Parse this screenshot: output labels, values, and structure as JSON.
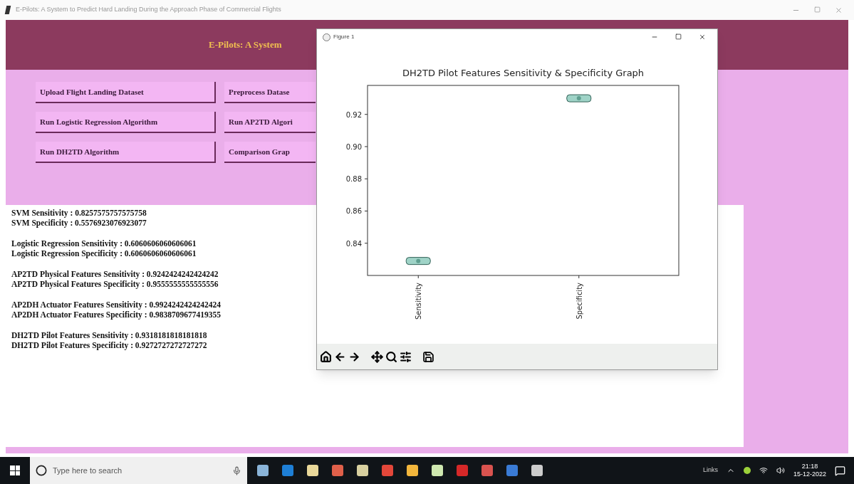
{
  "window": {
    "title": "E-Pilots: A System to Predict Hard Landing During the Approach Phase of Commercial Flights"
  },
  "header": {
    "title": "E-Pilots: A System"
  },
  "buttons": [
    [
      "Upload Flight Landing Dataset",
      "Preprocess Datase"
    ],
    [
      "Run Logistic Regression Algorithm",
      "Run AP2TD Algori"
    ],
    [
      "Run DH2TD Algorithm",
      "Comparison Grap"
    ]
  ],
  "results": [
    [
      "SVM Sensitivity : 0.8257575757575758",
      "SVM Specificity : 0.5576923076923077"
    ],
    [
      "Logistic Regression Sensitivity : 0.6060606060606061",
      "Logistic Regression Specificity : 0.6060606060606061"
    ],
    [
      "AP2TD Physical Features Sensitivity : 0.9242424242424242",
      "AP2TD Physical Features Specificity : 0.9555555555555556"
    ],
    [
      "AP2DH Actuator Features Sensitivity : 0.9924242424242424",
      "AP2DH Actuator Features Specificity : 0.9838709677419355"
    ],
    [
      "DH2TD Pilot Features Sensitivity : 0.9318181818181818",
      "DH2TD Pilot Features Specificity : 0.9272727272727272"
    ]
  ],
  "figure": {
    "title": "Figure 1",
    "chart_data": {
      "type": "scatter",
      "title": "DH2TD Pilot Features Sensitivity & Specificity Graph",
      "categories": [
        "Sensitivity",
        "Specificity"
      ],
      "values": [
        0.829,
        0.93
      ],
      "ylim": [
        0.82,
        0.938
      ],
      "yticks": [
        {
          "value": 0.84,
          "label": "0.84"
        },
        {
          "value": 0.86,
          "label": "0.86"
        },
        {
          "value": 0.88,
          "label": "0.88"
        },
        {
          "value": 0.9,
          "label": "0.90"
        },
        {
          "value": 0.92,
          "label": "0.92"
        }
      ]
    }
  },
  "taskbar": {
    "search": {
      "placeholder": "Type here to search"
    },
    "links": "Links",
    "time": "21:18",
    "date": "15-12-2022"
  }
}
